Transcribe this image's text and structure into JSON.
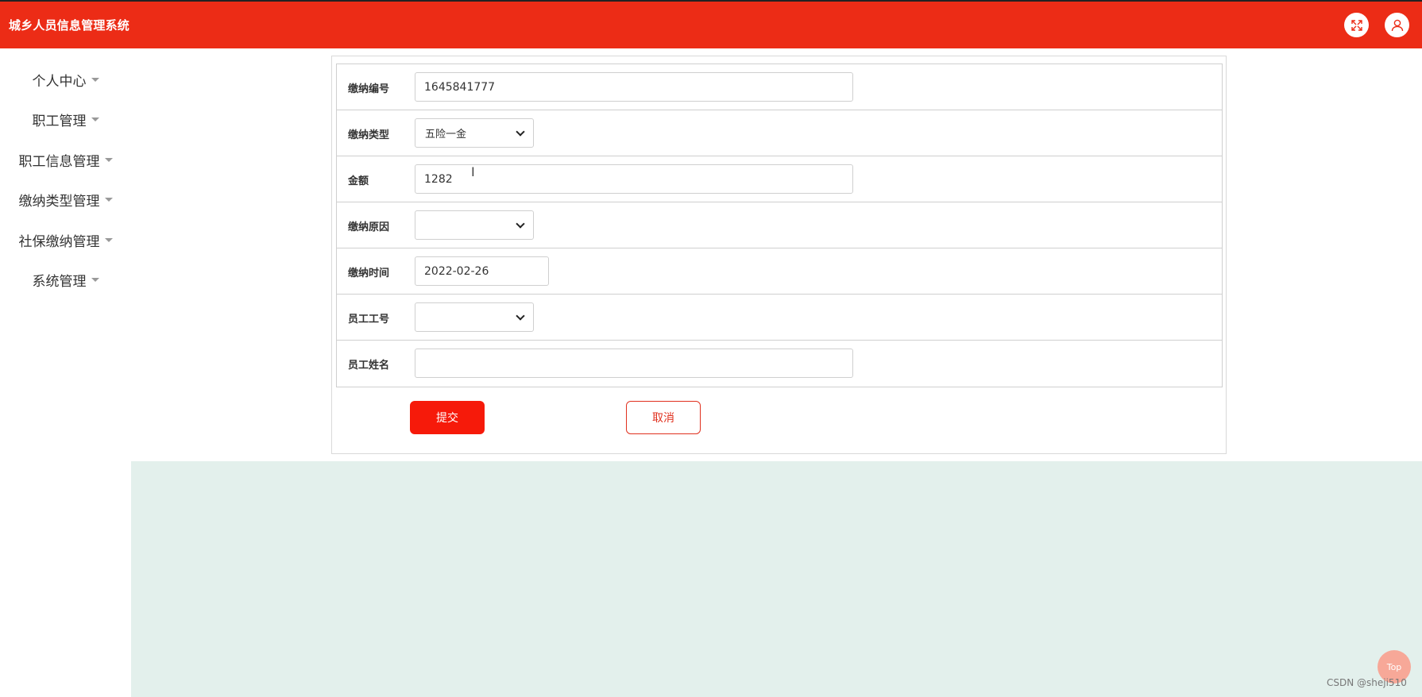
{
  "header": {
    "title": "城乡人员信息管理系统",
    "fullscreen_icon": "fullscreen-icon",
    "user_icon": "user-icon",
    "accent": "#ec2c16"
  },
  "sidebar": {
    "items": [
      {
        "label": "个人中心"
      },
      {
        "label": "职工管理"
      },
      {
        "label": "职工信息管理"
      },
      {
        "label": "缴纳类型管理"
      },
      {
        "label": "社保缴纳管理"
      },
      {
        "label": "系统管理"
      }
    ]
  },
  "form": {
    "fields": [
      {
        "label": "缴纳编号",
        "value": "1645841777"
      },
      {
        "label": "缴纳类型",
        "value": "五险一金"
      },
      {
        "label": "金额",
        "value": "1282"
      },
      {
        "label": "缴纳原因",
        "value": ""
      },
      {
        "label": "缴纳时间",
        "value": "2022-02-26"
      },
      {
        "label": "员工工号",
        "value": ""
      },
      {
        "label": "员工姓名",
        "value": ""
      }
    ],
    "submit_label": "提交",
    "cancel_label": "取消"
  },
  "misc": {
    "top_label": "Top",
    "watermark": "CSDN @sheji510",
    "text_cursor": "I"
  }
}
